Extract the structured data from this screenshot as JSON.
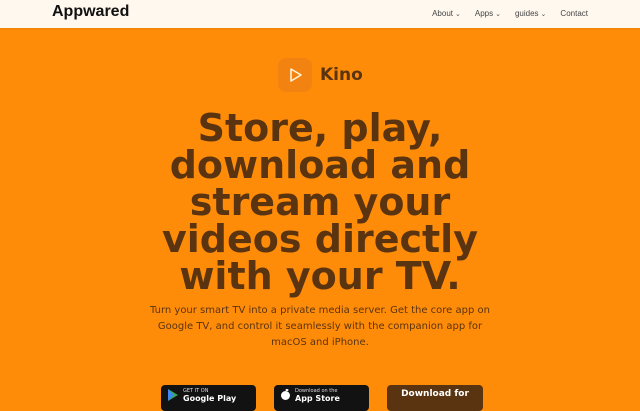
{
  "header": {
    "brand": "Appwared",
    "nav": [
      {
        "label": "About",
        "has_menu": true
      },
      {
        "label": "Apps",
        "has_menu": true
      },
      {
        "label": "guides",
        "has_menu": true
      },
      {
        "label": "Contact",
        "has_menu": false
      }
    ]
  },
  "hero": {
    "app_name": "Kino",
    "headline": "Store, play, download and stream your videos directly with your TV.",
    "description": "Turn your smart TV into a private media server. Get the core app on Google TV, and control it seamlessly with the companion app for macOS and iPhone."
  },
  "badges": {
    "google_play": {
      "small": "GET IT ON",
      "big": "Google Play",
      "icon": "google-play-icon"
    },
    "app_store": {
      "small": "Download on the",
      "big": "App Store",
      "icon": "apple-icon"
    },
    "download": {
      "label": "Download for"
    }
  },
  "colors": {
    "background": "#ff8c08",
    "header_bg": "#fff8ef",
    "text_brown": "#5a3410",
    "icon_bg": "#f28310"
  }
}
